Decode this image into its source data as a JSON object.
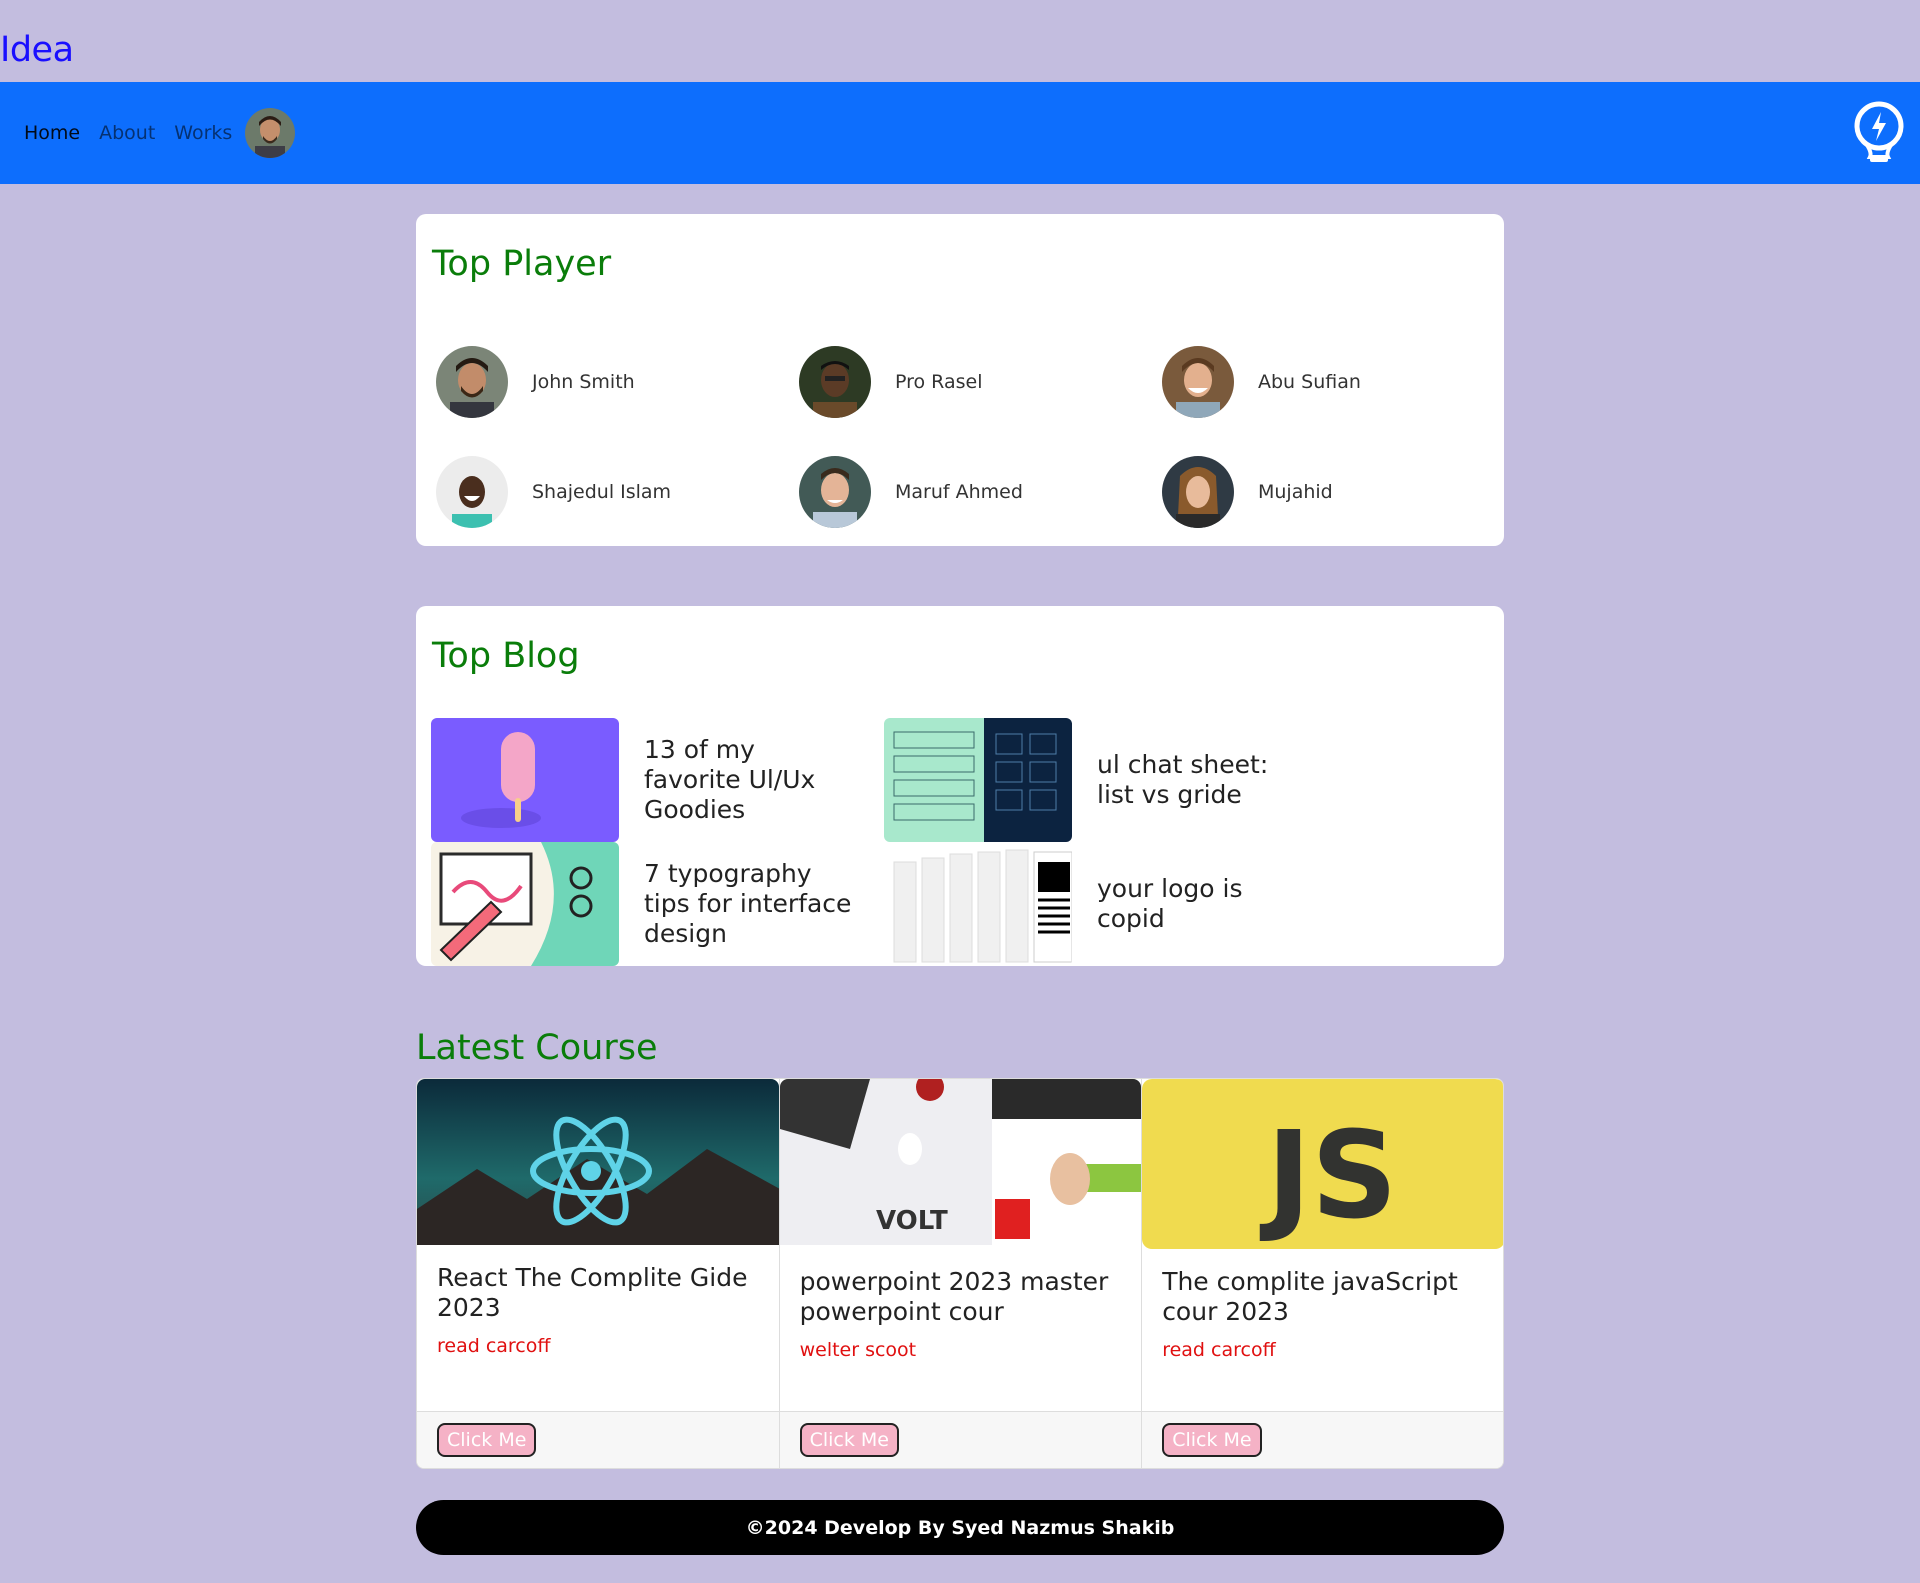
{
  "brand": "Idea",
  "nav": {
    "links": [
      "Home",
      "About",
      "Works"
    ]
  },
  "players": {
    "title": "Top Player",
    "items": [
      {
        "name": "John Smith"
      },
      {
        "name": "Pro Rasel"
      },
      {
        "name": "Abu Sufian"
      },
      {
        "name": "Shajedul Islam"
      },
      {
        "name": "Maruf Ahmed"
      },
      {
        "name": "Mujahid"
      }
    ]
  },
  "blog": {
    "title": "Top Blog",
    "items": [
      {
        "title": "13 of my favorite Ul/Ux Goodies"
      },
      {
        "title": "ul chat sheet: list vs gride"
      },
      {
        "title": "7 typography tips for interface design"
      },
      {
        "title": "your logo is copid"
      }
    ]
  },
  "courses": {
    "title": "Latest Course",
    "items": [
      {
        "name": "React The Complite Gide 2023",
        "author": "read carcoff",
        "button": "Click Me"
      },
      {
        "name": "powerpoint 2023 master powerpoint cour",
        "author": "welter scoot",
        "button": "Click Me"
      },
      {
        "name": "The complite javaScript cour 2023",
        "author": "read carcoff",
        "button": "Click Me"
      }
    ],
    "images": {
      "react": "",
      "volt": "VOLT",
      "js": "JS"
    }
  },
  "footer": "©2024 Develop By Syed Nazmus Shakib",
  "colors": {
    "bg": "#c3bddf",
    "navbar": "#0d6efd",
    "title": "#0a7d0a",
    "brand": "#1a0fff"
  }
}
